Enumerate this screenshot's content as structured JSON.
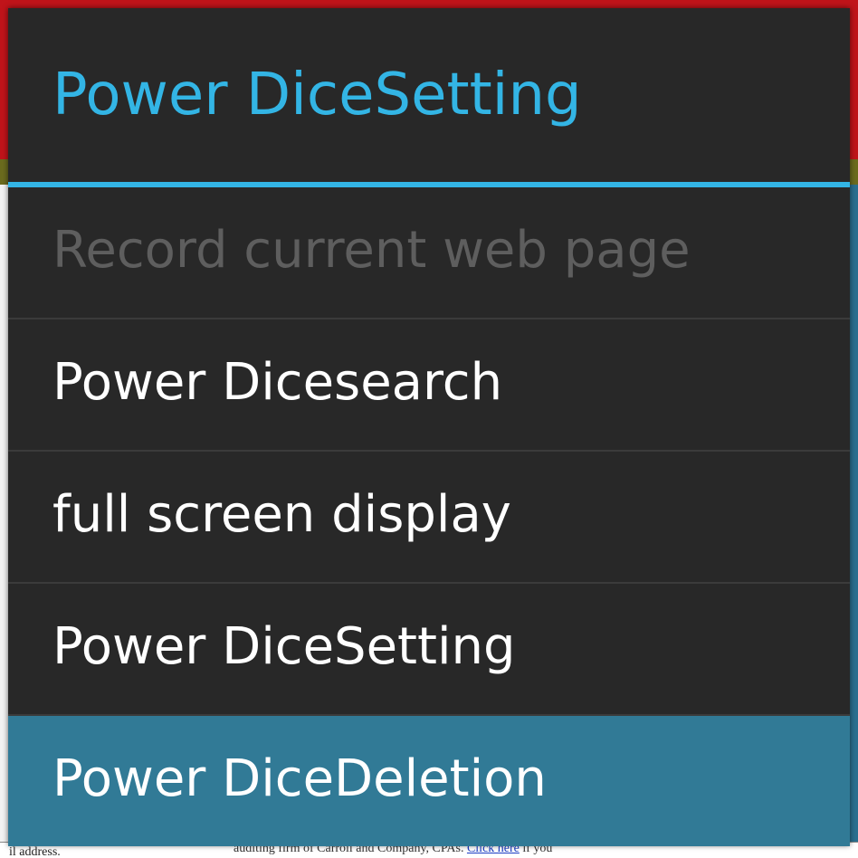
{
  "dialog": {
    "title": "Power DiceSetting",
    "items": [
      {
        "label": "Record current web page",
        "state": "disabled"
      },
      {
        "label": "Power Dicesearch",
        "state": "normal"
      },
      {
        "label": "full screen display",
        "state": "normal"
      },
      {
        "label": "Power DiceSetting",
        "state": "normal"
      },
      {
        "label": "Power DiceDeletion",
        "state": "selected"
      }
    ]
  },
  "background_page": {
    "footer_left": "il address.",
    "footer_text": "auditing firm of Carroll and Company, CPAs.",
    "footer_link": "Click here",
    "footer_tail": "if you"
  },
  "colors": {
    "accent": "#33b5e5",
    "dialog_bg": "#282828",
    "selected_bg": "#317a96",
    "disabled_text": "#5e5e5e",
    "text": "#ffffff"
  }
}
